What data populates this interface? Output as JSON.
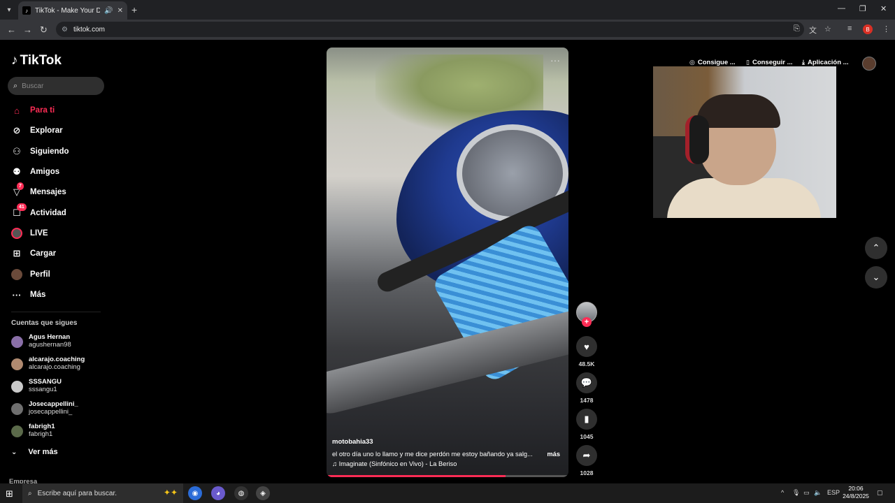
{
  "browser": {
    "tab_title": "TikTok - Make Your Day",
    "url": "tiktok.com",
    "profile_initial": "B"
  },
  "sidebar": {
    "logo": "TikTok",
    "search_placeholder": "Buscar",
    "nav": [
      {
        "label": "Para ti",
        "icon": "home-icon",
        "active": true
      },
      {
        "label": "Explorar",
        "icon": "compass-icon"
      },
      {
        "label": "Siguiendo",
        "icon": "following-icon"
      },
      {
        "label": "Amigos",
        "icon": "friends-icon"
      },
      {
        "label": "Mensajes",
        "icon": "messages-icon",
        "badge": "7"
      },
      {
        "label": "Actividad",
        "icon": "activity-icon",
        "badge": "41"
      },
      {
        "label": "LIVE",
        "icon": "live-icon"
      },
      {
        "label": "Cargar",
        "icon": "upload-icon"
      },
      {
        "label": "Perfil",
        "icon": "profile-icon"
      },
      {
        "label": "Más",
        "icon": "more-icon"
      }
    ],
    "following_title": "Cuentas que sigues",
    "following": [
      {
        "name": "Agus Hernan",
        "handle": "agushernan98"
      },
      {
        "name": "alcarajo.coaching",
        "handle": "alcarajo.coaching"
      },
      {
        "name": "SSSANGU",
        "handle": "sssangu1"
      },
      {
        "name": "Josecappellini_",
        "handle": "josecappellini_"
      },
      {
        "name": "fabrigh1",
        "handle": "fabrigh1"
      }
    ],
    "see_more": "Ver más",
    "company": "Empresa"
  },
  "video": {
    "username": "motobahia33",
    "description": "el otro día uno lo llamo y me dice perdón  me estoy bañando ya salg...",
    "more": "más",
    "music": "Imaginate (Sinfónico en Vivo) - La Beriso",
    "progress": 0.74
  },
  "actions": {
    "likes": "48.5K",
    "comments": "1478",
    "saves": "1045",
    "shares": "1028"
  },
  "header": {
    "link1": "Consigue ...",
    "link2": "Conseguir ...",
    "link3": "Aplicación ..."
  },
  "taskbar": {
    "search_placeholder": "Escribe aquí para buscar.",
    "language": "ESP",
    "time": "20:06",
    "date": "24/8/2025"
  }
}
